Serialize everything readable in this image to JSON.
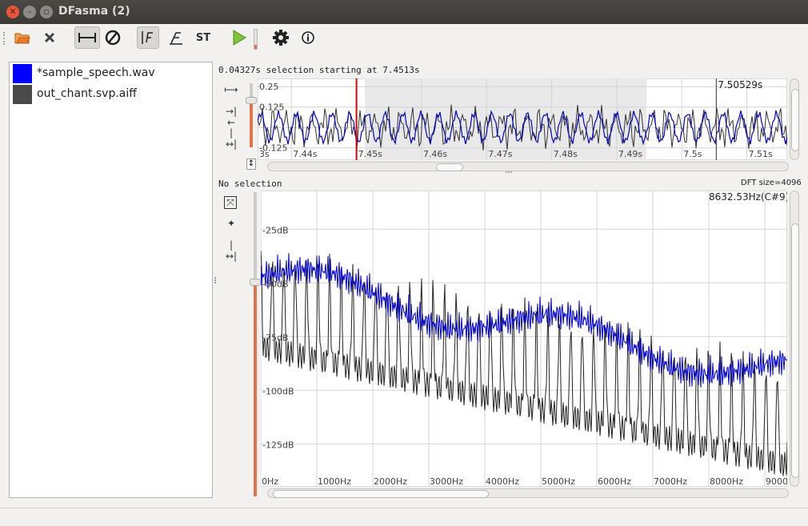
{
  "window": {
    "title": "DFasma (2)"
  },
  "toolbar": {
    "items": [
      {
        "name": "open-file-icon",
        "active": false
      },
      {
        "name": "close-file-icon",
        "active": false
      },
      {
        "name": "selection-mode-icon",
        "active": true
      },
      {
        "name": "edit-mode-icon",
        "active": false
      },
      {
        "name": "show-spectrum-icon",
        "active": true
      },
      {
        "name": "show-f0-icon",
        "active": false
      },
      {
        "name": "show-spectrogram-icon",
        "active": false
      },
      {
        "name": "play-icon",
        "active": false
      },
      {
        "name": "settings-icon",
        "active": false
      },
      {
        "name": "about-icon",
        "active": false
      }
    ]
  },
  "files": [
    {
      "name": "*sample_speech.wav",
      "color": "#0000ff"
    },
    {
      "name": "out_chant.svp.aiff",
      "color": "#4a4a4a"
    }
  ],
  "waveform": {
    "status": "0.04327s selection  starting at 7.4513s",
    "cursor_time": "7.50529s",
    "y_ticks": [
      "0.25",
      "0.125",
      "-0.125"
    ],
    "x_ticks": [
      "3s",
      "7.44s",
      "7.45s",
      "7.46s",
      "7.47s",
      "7.48s",
      "7.49s",
      "7.5s",
      "7.51s"
    ],
    "x_range": [
      7.4348,
      7.5162
    ],
    "y_range": [
      -0.2,
      0.3
    ],
    "selection_range": [
      7.4513,
      7.4946
    ],
    "playhead": 7.45,
    "cursor": 7.5053
  },
  "spectrum": {
    "status": "No selection",
    "dft": "DFT size=4096",
    "cursor_freq": "8632.53Hz(C#9)",
    "y_ticks": [
      "-25dB",
      "-50dB",
      "-75dB",
      "-100dB",
      "-125dB"
    ],
    "x_ticks": [
      "0Hz",
      "1000Hz",
      "2000Hz",
      "3000Hz",
      "4000Hz",
      "5000Hz",
      "6000Hz",
      "7000Hz",
      "8000Hz",
      "9000Hz"
    ],
    "x_range": [
      0,
      9400
    ],
    "y_range": [
      -145,
      -7
    ]
  },
  "colors": {
    "selection_marker": "#e00000",
    "accent": "#e0744a",
    "speech": "#0000cc",
    "chant": "#222222"
  }
}
